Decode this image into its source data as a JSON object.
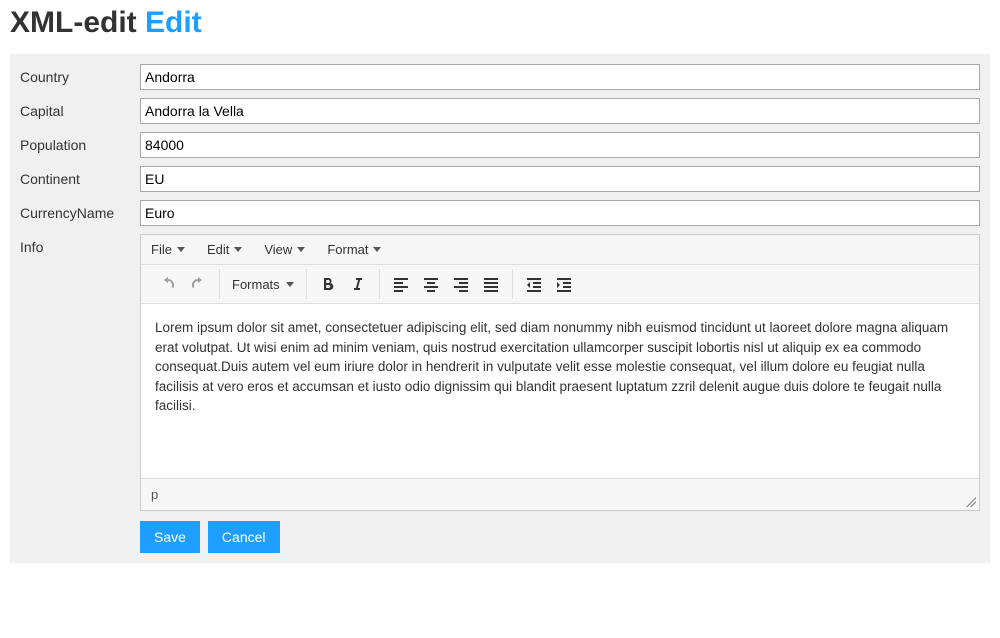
{
  "page": {
    "title_main": "XML-edit",
    "title_accent": "Edit"
  },
  "form": {
    "country": {
      "label": "Country",
      "value": "Andorra"
    },
    "capital": {
      "label": "Capital",
      "value": "Andorra la Vella"
    },
    "population": {
      "label": "Population",
      "value": "84000"
    },
    "continent": {
      "label": "Continent",
      "value": "EU"
    },
    "currencyName": {
      "label": "CurrencyName",
      "value": "Euro"
    },
    "info": {
      "label": "Info"
    }
  },
  "editor": {
    "menubar": {
      "file": "File",
      "edit": "Edit",
      "view": "View",
      "format": "Format"
    },
    "toolbar": {
      "formats_label": "Formats"
    },
    "content": "Lorem ipsum dolor sit amet, consectetuer adipiscing elit, sed diam nonummy nibh euismod tincidunt ut laoreet dolore magna aliquam erat volutpat. Ut wisi enim ad minim veniam, quis nostrud exercitation ullamcorper suscipit lobortis nisl ut aliquip ex ea commodo consequat.Duis autem vel eum iriure dolor in hendrerit in vulputate velit esse molestie consequat, vel illum dolore eu feugiat nulla facilisis at vero eros et accumsan et iusto odio dignissim qui blandit praesent luptatum zzril delenit augue duis dolore te feugait nulla facilisi.",
    "status_path": "p"
  },
  "actions": {
    "save": "Save",
    "cancel": "Cancel"
  }
}
